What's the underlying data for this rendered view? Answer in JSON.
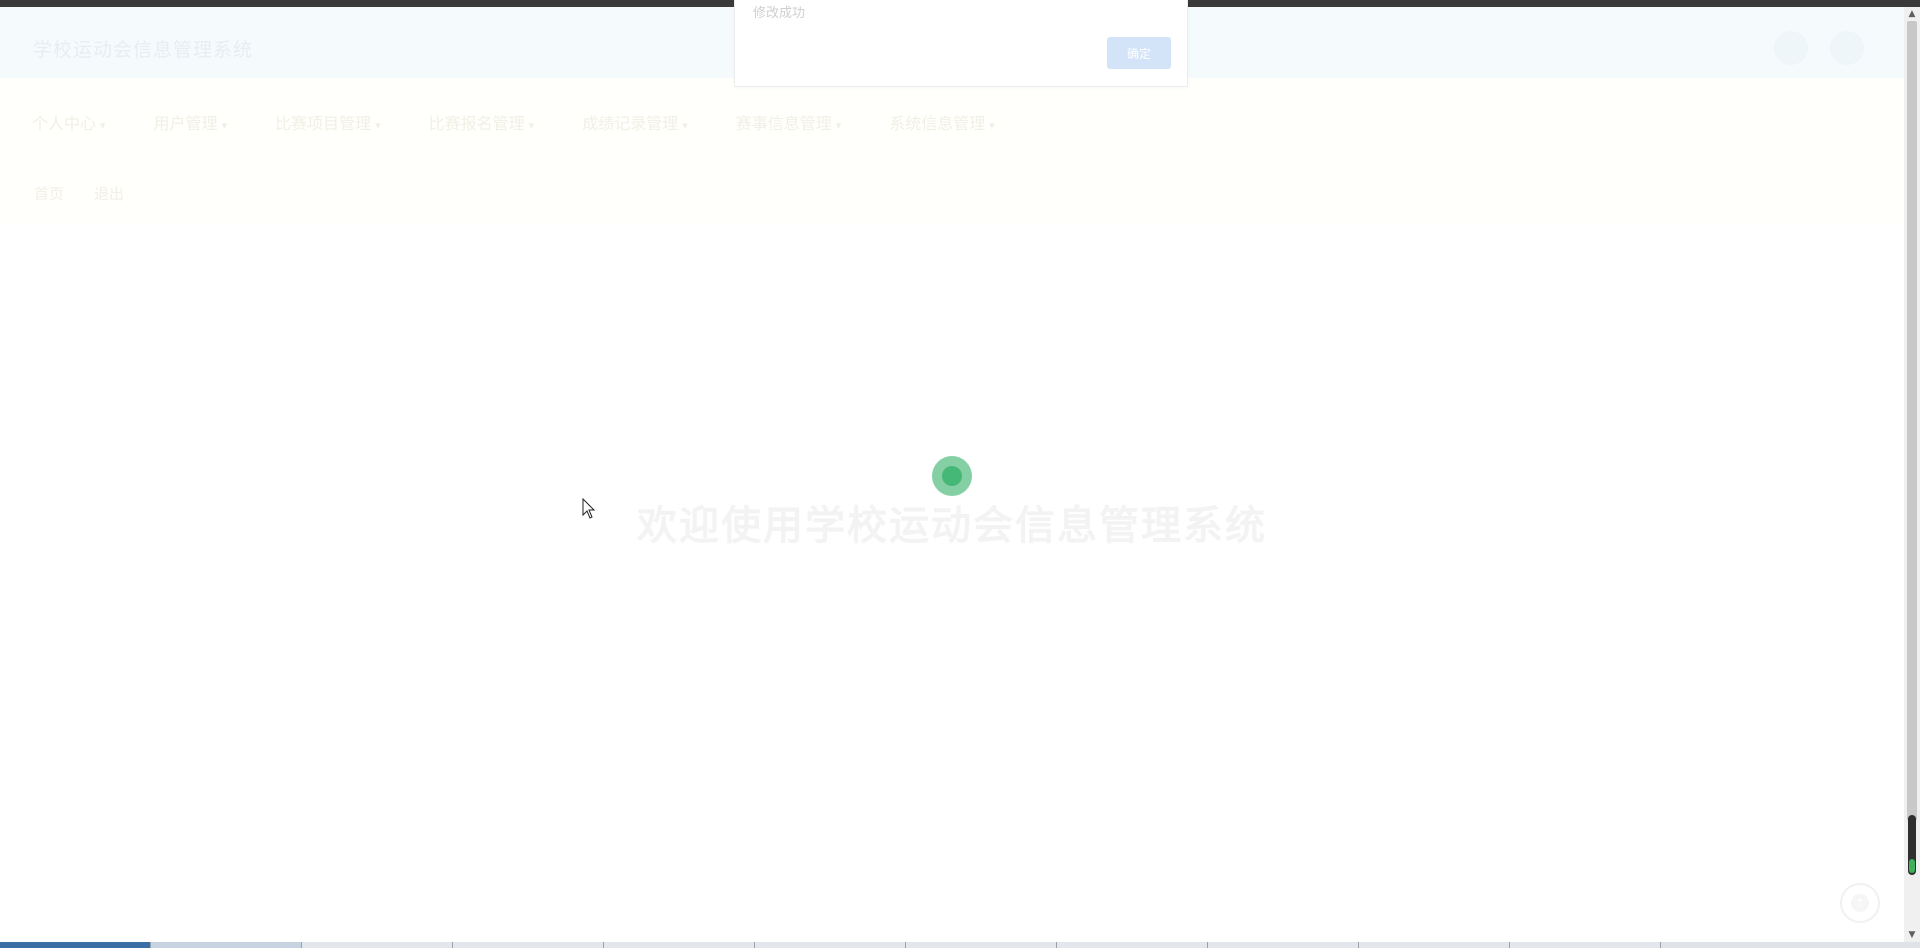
{
  "header": {
    "title": "学校运动会信息管理系统"
  },
  "nav": {
    "items": [
      {
        "label": "个人中心"
      },
      {
        "label": "用户管理"
      },
      {
        "label": "比赛项目管理"
      },
      {
        "label": "比赛报名管理"
      },
      {
        "label": "成绩记录管理"
      },
      {
        "label": "赛事信息管理"
      },
      {
        "label": "系统信息管理"
      }
    ],
    "row2": [
      "首页",
      "退出"
    ]
  },
  "main": {
    "welcome": "欢迎使用学校运动会信息管理系统"
  },
  "dialog": {
    "message": "修改成功",
    "ok_label": "确定"
  },
  "icons": {
    "header_left": "message-icon",
    "header_right": "avatar",
    "back_to_top": "arrow-up-icon",
    "spinner": "loading-spinner"
  },
  "colors": {
    "spinner": "#45b877",
    "ok_button": "#d3e4f8"
  }
}
